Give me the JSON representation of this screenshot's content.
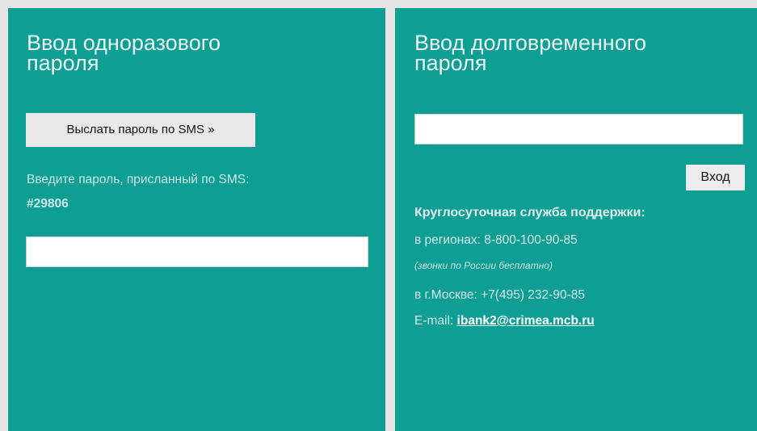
{
  "one_time": {
    "title": "Ввод одноразового\nпароля",
    "send_sms_button": "Выслать пароль по SMS »",
    "hint": "Введите пароль, присланный по SMS:",
    "code": "#29806",
    "password_value": ""
  },
  "long_term": {
    "title": "Ввод долговременного\nпароля",
    "password_value": "",
    "enter_button": "Вход",
    "support_title": "Круглосуточная служба поддержки:",
    "region_phone": "в регионах: 8-800-100-90-85",
    "free_note": "(звонки по России бесплатно)",
    "moscow_phone": "в г.Москве: +7(495) 232-90-85",
    "email_label": "E-mail: ",
    "email_link": "ibank2@crimea.mcb.ru"
  },
  "colors": {
    "panel_bg": "#0e9e94",
    "page_bg": "#e6e6e6"
  }
}
